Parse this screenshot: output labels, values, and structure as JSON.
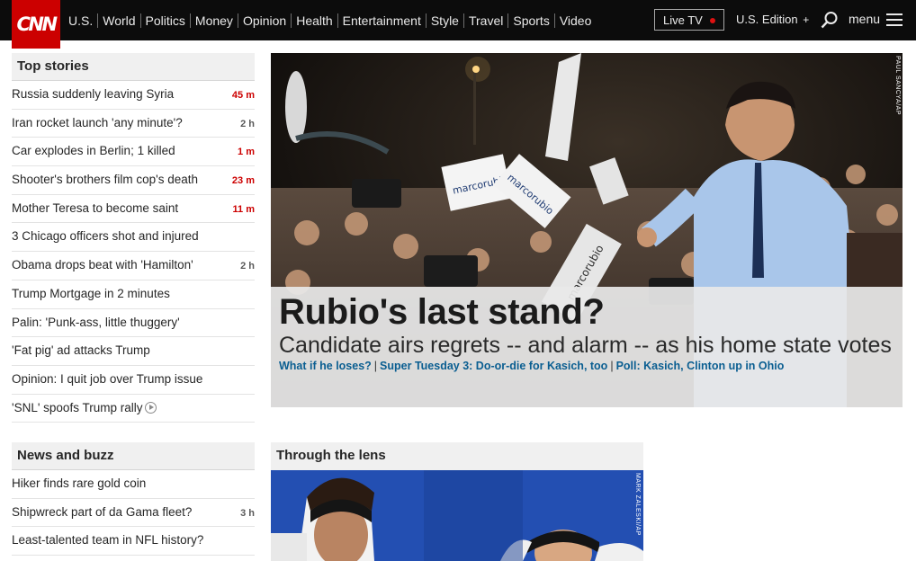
{
  "header": {
    "logo": "CNN",
    "nav": [
      "U.S.",
      "World",
      "Politics",
      "Money",
      "Opinion",
      "Health",
      "Entertainment",
      "Style",
      "Travel",
      "Sports",
      "Video"
    ],
    "live_tv": "Live TV",
    "edition": "U.S. Edition",
    "edition_plus": "+",
    "menu": "menu"
  },
  "top_stories": {
    "title": "Top stories",
    "items": [
      {
        "text": "Russia suddenly leaving Syria",
        "time": "45 m"
      },
      {
        "text": "Iran rocket launch 'any minute'?",
        "time": "2 h"
      },
      {
        "text": "Car explodes in Berlin; 1 killed",
        "time": "1 m"
      },
      {
        "text": "Shooter's brothers film cop's death",
        "time": "23 m"
      },
      {
        "text": "Mother Teresa to become saint",
        "time": "11 m"
      },
      {
        "text": "3 Chicago officers shot and injured",
        "time": ""
      },
      {
        "text": "Obama drops beat with 'Hamilton'",
        "time": "2 h"
      },
      {
        "text": "Trump Mortgage in 2 minutes",
        "time": ""
      },
      {
        "text": "Palin: 'Punk-ass, little thuggery'",
        "time": ""
      },
      {
        "text": "'Fat pig' ad attacks Trump",
        "time": ""
      },
      {
        "text": "Opinion: I quit job over Trump issue",
        "time": ""
      },
      {
        "text": "'SNL' spoofs Trump rally",
        "time": ""
      }
    ]
  },
  "news_buzz": {
    "title": "News and buzz",
    "items": [
      {
        "text": "Hiker finds rare gold coin",
        "time": ""
      },
      {
        "text": "Shipwreck part of da Gama fleet?",
        "time": "3 h"
      },
      {
        "text": "Least-talented team in NFL history?",
        "time": ""
      }
    ]
  },
  "hero": {
    "title": "Rubio's last stand?",
    "dek": "Candidate airs regrets -- and alarm -- as his home state votes",
    "links": [
      "What if he loses?",
      "Super Tuesday 3: Do-or-die for Kasich, too",
      "Poll: Kasich, Clinton up in Ohio"
    ],
    "sign_text": "marcorubio",
    "credit": "PAUL SANCYA/AP"
  },
  "lens": {
    "title": "Through the lens",
    "credit": "MARK ZALESKI/AP"
  },
  "colors": {
    "brand": "#cc0000",
    "link": "#0a5e91",
    "recent": "#cc0000"
  }
}
